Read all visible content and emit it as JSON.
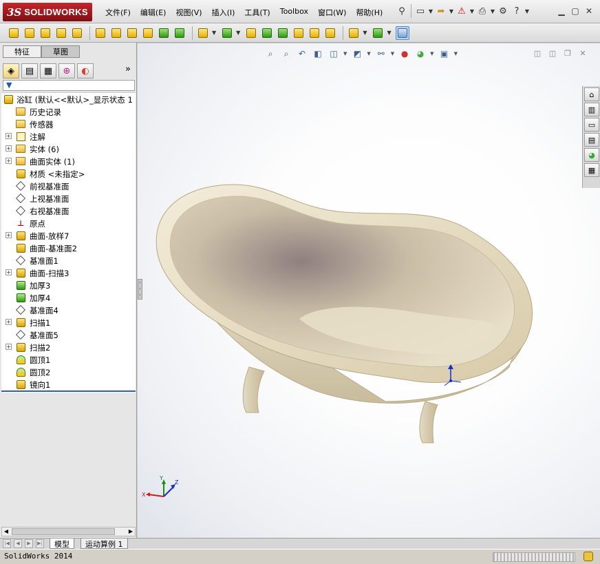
{
  "app": {
    "brand_ds": "3S",
    "brand_name": "SOLIDWORKS"
  },
  "menu": [
    "文件(F)",
    "编辑(E)",
    "视图(V)",
    "插入(I)",
    "工具(T)",
    "Toolbox",
    "窗口(W)",
    "帮助(H)"
  ],
  "quick_access": [
    "pushpin-icon",
    "new-document-icon",
    "open-icon",
    "rebuild-warning-icon",
    "print-icon",
    "options-icon",
    "help-icon"
  ],
  "command_toolbar": {
    "icons": [
      "extrude-icon",
      "revolve-icon",
      "sweep-icon",
      "loft-icon",
      "boundary-icon",
      "extruded-cut-icon",
      "hole-wizard-icon",
      "revolved-cut-icon",
      "swept-cut-icon",
      "lofted-cut-icon",
      "boundary-cut-icon",
      "fillet-icon",
      "linear-pattern-icon",
      "rib-icon",
      "draft-icon",
      "shell-icon",
      "wrap-icon",
      "intersect-icon",
      "mirror-icon",
      "reference-geometry-icon",
      "curves-icon",
      "instant3d-icon"
    ],
    "selected": "instant3d-icon"
  },
  "left_panel": {
    "tabs": [
      "特征",
      "草图"
    ],
    "active_tab": "草图",
    "managers": [
      "featuremanager-icon",
      "propertymanager-icon",
      "configurationmanager-icon",
      "dimxpertmanager-icon",
      "displaymanager-icon"
    ],
    "more": "»",
    "filter_icon": "filter-icon"
  },
  "feature_tree": {
    "root": "浴缸  (默认<<默认>_显示状态 1",
    "items": [
      {
        "label": "历史记录",
        "icon": "history-icon",
        "expand": ""
      },
      {
        "label": "传感器",
        "icon": "sensor-icon",
        "expand": ""
      },
      {
        "label": "注解",
        "icon": "annotation-icon",
        "expand": "+"
      },
      {
        "label": "实体 (6)",
        "icon": "solid-bodies-icon",
        "expand": "+"
      },
      {
        "label": "曲面实体 (1)",
        "icon": "surface-bodies-icon",
        "expand": "+"
      },
      {
        "label": "材质 <未指定>",
        "icon": "material-icon",
        "expand": ""
      },
      {
        "label": "前视基准面",
        "icon": "plane-icon",
        "expand": ""
      },
      {
        "label": "上视基准面",
        "icon": "plane-icon",
        "expand": ""
      },
      {
        "label": "右视基准面",
        "icon": "plane-icon",
        "expand": ""
      },
      {
        "label": "原点",
        "icon": "origin-icon",
        "expand": ""
      },
      {
        "label": "曲面-放样7",
        "icon": "surface-loft-icon",
        "expand": "+"
      },
      {
        "label": "曲面-基准面2",
        "icon": "planar-surface-icon",
        "expand": ""
      },
      {
        "label": "基准面1",
        "icon": "plane-icon",
        "expand": ""
      },
      {
        "label": "曲面-扫描3",
        "icon": "surface-sweep-icon",
        "expand": "+"
      },
      {
        "label": "加厚3",
        "icon": "thicken-icon",
        "expand": ""
      },
      {
        "label": "加厚4",
        "icon": "thicken-icon",
        "expand": ""
      },
      {
        "label": "基准面4",
        "icon": "plane-icon",
        "expand": ""
      },
      {
        "label": "扫描1",
        "icon": "sweep-icon",
        "expand": "+"
      },
      {
        "label": "基准面5",
        "icon": "plane-icon",
        "expand": ""
      },
      {
        "label": "扫描2",
        "icon": "sweep-icon",
        "expand": "+"
      },
      {
        "label": "圆顶1",
        "icon": "dome-icon",
        "expand": ""
      },
      {
        "label": "圆顶2",
        "icon": "dome-icon",
        "expand": ""
      },
      {
        "label": "镜向1",
        "icon": "mirror-icon",
        "expand": ""
      }
    ]
  },
  "heads_up_toolbar": [
    "zoom-to-fit-icon",
    "zoom-to-area-icon",
    "previous-view-icon",
    "section-view-icon",
    "view-orientation-icon",
    "display-style-icon",
    "hide-show-icon",
    "edit-appearance-icon",
    "apply-scene-icon",
    "view-settings-icon"
  ],
  "task_pane": [
    "home-icon",
    "design-library-icon",
    "file-explorer-icon",
    "view-palette-icon",
    "appearances-icon",
    "custom-properties-icon"
  ],
  "triad": {
    "x": "X",
    "y": "Y",
    "z": "Z"
  },
  "bottom_tabs": [
    "模型",
    "运动算例 1"
  ],
  "active_bottom_tab": "模型",
  "status_text": "SolidWorks 2014",
  "colors": {
    "logo": "#a3181e",
    "tub_body": "#e6dcc6",
    "tub_inner": "#d8ccb0",
    "selection": "#b8d4f0"
  }
}
